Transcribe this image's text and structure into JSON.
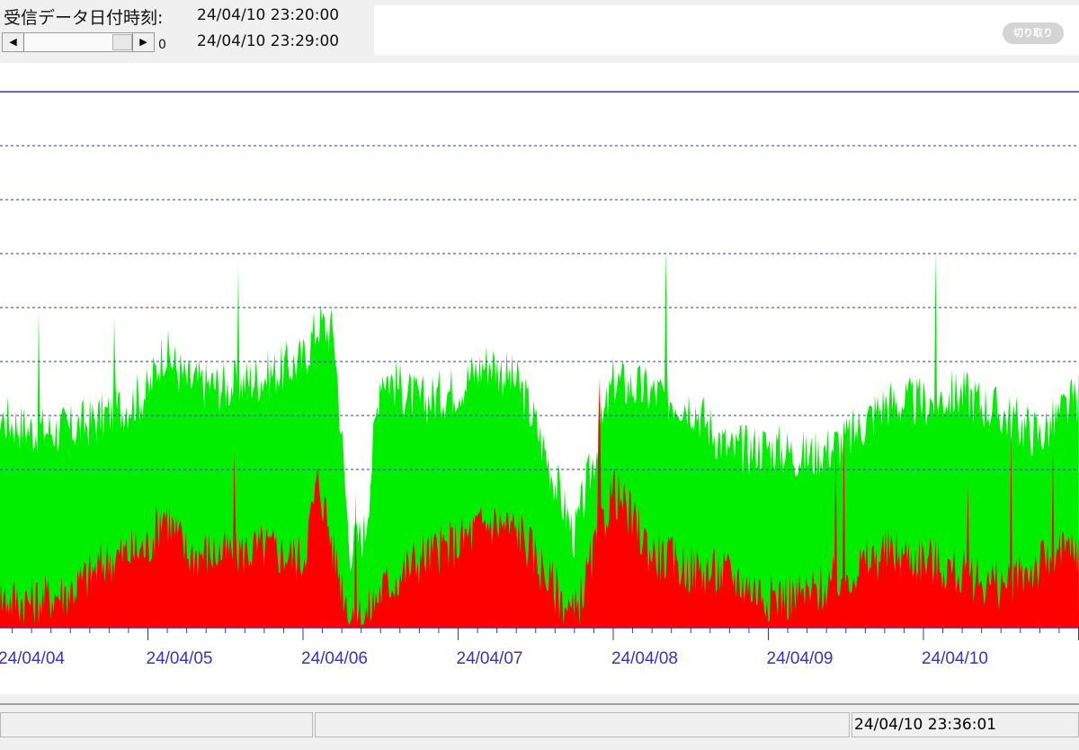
{
  "header": {
    "received_label": "受信データ日付時刻:",
    "time_start": "24/04/10 23:20:00",
    "time_end": "24/04/10 23:29:00",
    "scroll_value": "0",
    "cut_button_label": "切り取り"
  },
  "status": {
    "timestamp": "24/04/10 23:36:01"
  },
  "chart_data": {
    "type": "area",
    "x_tick_labels": [
      "24/04/04",
      "24/04/05",
      "24/04/06",
      "24/04/07",
      "24/04/08",
      "24/04/09",
      "24/04/10"
    ],
    "colors": {
      "green_series": "#00ee00",
      "red_series": "#ff0000",
      "grid": "#3333cc",
      "axis_label": "#3333cc"
    },
    "grid": true,
    "series": [
      {
        "color": "green",
        "x": [
          0,
          0.25,
          0.5,
          0.75,
          1,
          1.1,
          1.25,
          1.5,
          1.75,
          2,
          2.1,
          2.2,
          2.3,
          2.4,
          2.5,
          2.75,
          3,
          3.2,
          3.4,
          3.5,
          3.75,
          4,
          4.25,
          4.5,
          4.75,
          5,
          5.25,
          5.5,
          5.75,
          6,
          6.25,
          6.5,
          6.75,
          7,
          7.05
        ],
        "y": [
          40,
          37,
          37,
          40,
          44,
          52,
          46,
          45,
          47,
          50,
          57,
          55,
          15,
          18,
          48,
          42,
          45,
          50,
          45,
          38,
          17,
          46,
          44,
          42,
          33,
          34,
          32,
          35,
          42,
          42,
          44,
          40,
          36,
          43,
          48
        ]
      },
      {
        "color": "red",
        "x": [
          0,
          0.25,
          0.5,
          0.75,
          1,
          1.1,
          1.25,
          1.5,
          1.75,
          2,
          2.1,
          2.2,
          2.3,
          2.4,
          2.5,
          2.75,
          3,
          3.2,
          3.4,
          3.5,
          3.75,
          4,
          4.25,
          4.5,
          4.75,
          5,
          5.25,
          5.5,
          5.75,
          6,
          6.25,
          6.5,
          6.75,
          7,
          7.05
        ],
        "y": [
          6,
          5,
          7,
          13,
          15,
          22,
          14,
          14,
          15,
          13,
          28,
          14,
          3,
          2,
          7,
          13,
          16,
          20,
          18,
          13,
          2,
          26,
          14,
          11,
          10,
          6,
          6,
          10,
          14,
          13,
          10,
          8,
          12,
          15,
          2
        ]
      }
    ]
  }
}
